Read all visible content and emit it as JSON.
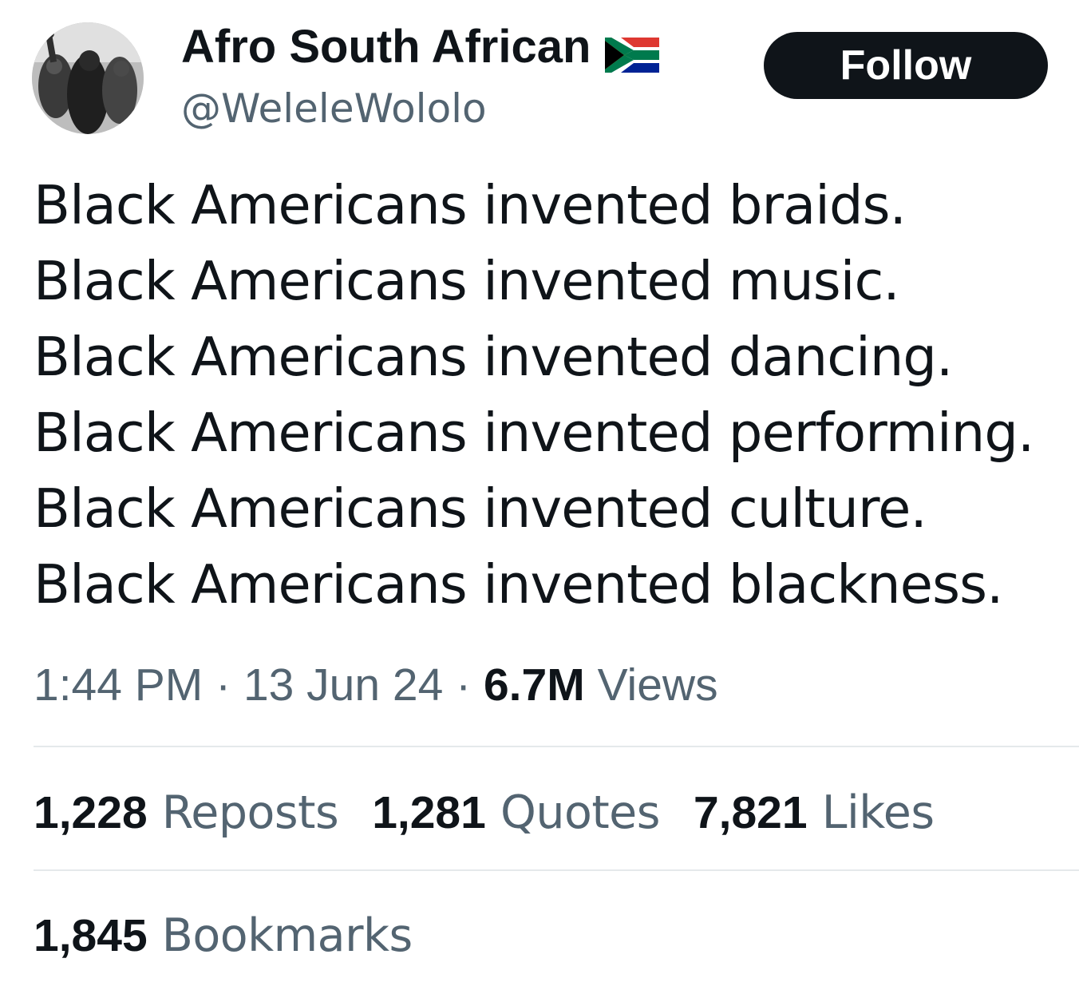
{
  "author": {
    "display_name": "Afro South African",
    "flag_icon": "south-africa-flag",
    "handle": "@WeleleWololo",
    "avatar_icon": "black-and-white-protest-photo"
  },
  "follow_label": "Follow",
  "tweet": {
    "lines": [
      "Black Americans invented braids.",
      "Black Americans invented music.",
      "Black Americans invented dancing.",
      "Black Americans invented performing.",
      "Black Americans invented culture.",
      "Black Americans invented blackness."
    ]
  },
  "meta": {
    "time": "1:44 PM",
    "separator": " · ",
    "date": "13 Jun 24",
    "views_count": "6.7M",
    "views_label": "Views"
  },
  "stats": [
    {
      "count": "1,228",
      "label": "Reposts"
    },
    {
      "count": "1,281",
      "label": "Quotes"
    },
    {
      "count": "7,821",
      "label": "Likes"
    }
  ],
  "bookmarks": {
    "count": "1,845",
    "label": "Bookmarks"
  },
  "colors": {
    "text_primary": "#0f1419",
    "text_secondary": "#536471",
    "button_bg": "#0f1419",
    "divider": "#e5e9eb"
  }
}
